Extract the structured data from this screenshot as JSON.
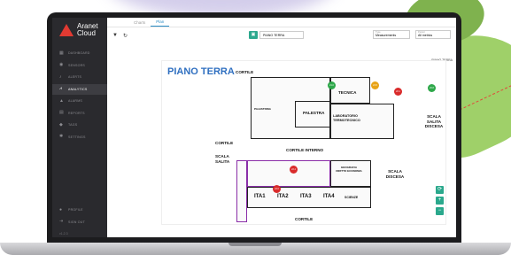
{
  "app": {
    "brand_line1": "Aranet",
    "brand_line2": "Cloud",
    "version": "v1.2.3"
  },
  "sidebar": {
    "items": [
      {
        "label": "DASHBOARD",
        "icon": "dashboard-icon"
      },
      {
        "label": "SENSORS",
        "icon": "sensor-icon"
      },
      {
        "label": "ALERTS",
        "icon": "alert-icon"
      },
      {
        "label": "ANALYTICS",
        "icon": "chart-icon",
        "active": true
      },
      {
        "label": "ALARMS",
        "icon": "warning-icon"
      },
      {
        "label": "REPORTS",
        "icon": "report-icon"
      },
      {
        "label": "TAGS",
        "icon": "tag-icon"
      },
      {
        "label": "SETTINGS",
        "icon": "gear-icon"
      }
    ],
    "bottom": [
      {
        "label": "PROFILE",
        "icon": "user-icon"
      },
      {
        "label": "SIGN OUT",
        "icon": "logout-icon"
      }
    ]
  },
  "tabs": [
    {
      "label": "Charts"
    },
    {
      "label": "Plan",
      "active": true
    }
  ],
  "toolbar": {
    "floor_value": "PIANO TERRA",
    "select1_caption": "Type",
    "select1_value": "Measurements",
    "select2_caption": "Period",
    "select2_value": "All metrics"
  },
  "map": {
    "floor_label": "PIANO TERRA",
    "title": "PIANO TERRA",
    "labels": {
      "cortile_top": "CORTILE",
      "tecnica": "TECNICA",
      "palestra": "PALESTRA",
      "palestrina": "PALESTRINA",
      "lab": "LABORATORIO TERMOTECNICO",
      "scala_salita": "SCALA SALITA DISCESA",
      "cortile_left": "CORTILE",
      "scala_left": "SCALA SALITA",
      "cortile_interno": "CORTILE INTERNO",
      "geografia": "GEOGRAFIA DIRITTO ECONOMIA",
      "scala_discesa": "SCALA DISCESA",
      "ita1": "ITA1",
      "ita2": "ITA2",
      "ita3": "ITA3",
      "ita4": "ITA4",
      "scienze": "SCIENZE",
      "cortile_bottom": "CORTILE"
    },
    "sensors": [
      {
        "value": "21.0",
        "color": "#2ea84a"
      },
      {
        "value": "21.5",
        "color": "#e8a317"
      },
      {
        "value": "22.1",
        "color": "#d92b2b"
      },
      {
        "value": "20.8",
        "color": "#2ea84a"
      },
      {
        "value": "22.4",
        "color": "#d92b2b"
      },
      {
        "value": "22.0",
        "color": "#d92b2b"
      }
    ]
  },
  "zoom": {
    "reset_icon": "refresh-icon",
    "zoom_in_icon": "zoom-in-icon",
    "zoom_out_icon": "zoom-out-icon"
  },
  "colors": {
    "accent": "#2da88e",
    "brand": "#e23a32",
    "title": "#2f6fc0"
  }
}
